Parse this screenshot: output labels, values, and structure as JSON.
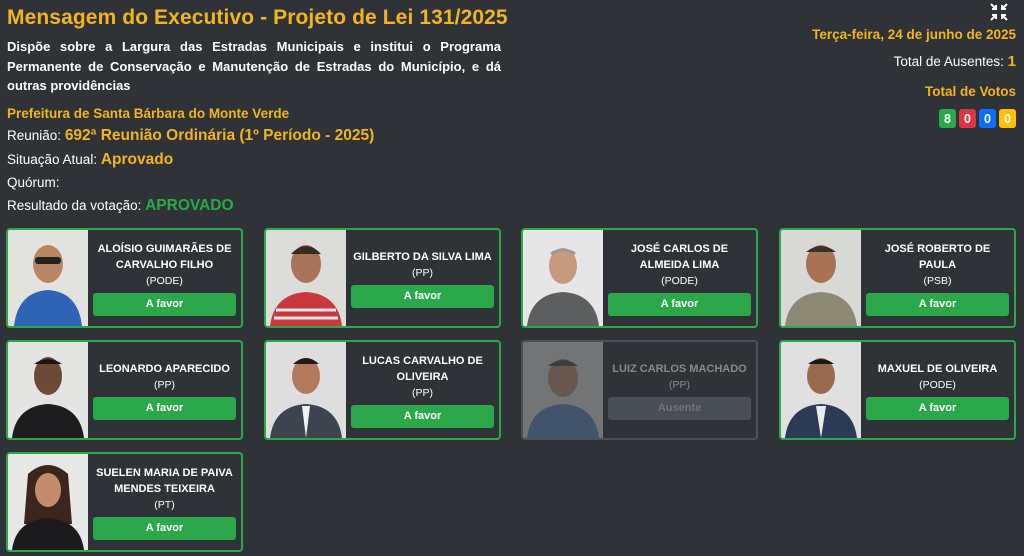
{
  "header": {
    "title": "Mensagem do Executivo - Projeto de Lei 131/2025",
    "subtitle": "Dispõe sobre a Largura das Estradas Municipais e institui o Programa Permanente de Conservação e Manutenção de Estradas do Município, e dá outras providências",
    "organization": "Prefeitura de Santa Bárbara do Monte Verde",
    "reuniao_label": "Reunião:",
    "reuniao_value": "692ª Reunião Ordinária (1º Período - 2025)",
    "situacao_label": "Situação Atual:",
    "situacao_value": "Aprovado",
    "quorum_label": "Quórum:",
    "resultado_label": "Resultado da votação:",
    "resultado_value": "APROVADO"
  },
  "summary": {
    "collapse_icon": "compress-icon",
    "date": "Terça-feira, 24 de junho de 2025",
    "absent_label": "Total de Ausentes:",
    "absent_count": "1",
    "votes_title": "Total de Votos",
    "votes": [
      {
        "value": "8",
        "color": "#2ba94a"
      },
      {
        "value": "0",
        "color": "#dc3545"
      },
      {
        "value": "0",
        "color": "#0d6efd"
      },
      {
        "value": "0",
        "color": "#ffc107"
      }
    ]
  },
  "colors": {
    "accent": "#f3b51f",
    "favor": "#2ba94a",
    "background": "#2f3236",
    "absent": "#6c757d"
  },
  "members": [
    {
      "name": "ALOÍSIO GUIMARÃES DE CARVALHO FILHO",
      "party": "(PODE)",
      "vote": "A favor"
    },
    {
      "name": "GILBERTO DA SILVA LIMA",
      "party": "(PP)",
      "vote": "A favor"
    },
    {
      "name": "JOSÉ CARLOS DE ALMEIDA LIMA",
      "party": "(PODE)",
      "vote": "A favor"
    },
    {
      "name": "JOSÉ ROBERTO DE PAULA",
      "party": "(PSB)",
      "vote": "A favor"
    },
    {
      "name": "LEONARDO APARECIDO",
      "party": "(PP)",
      "vote": "A favor"
    },
    {
      "name": "LUCAS CARVALHO DE OLIVEIRA",
      "party": "(PP)",
      "vote": "A favor"
    },
    {
      "name": "LUIZ CARLOS MACHADO",
      "party": "(PP)",
      "vote": "Ausente"
    },
    {
      "name": "MAXUEL DE OLIVEIRA",
      "party": "(PODE)",
      "vote": "A favor"
    },
    {
      "name": "SUELEN MARIA DE PAIVA MENDES TEIXEIRA",
      "party": "(PT)",
      "vote": "A favor"
    }
  ]
}
